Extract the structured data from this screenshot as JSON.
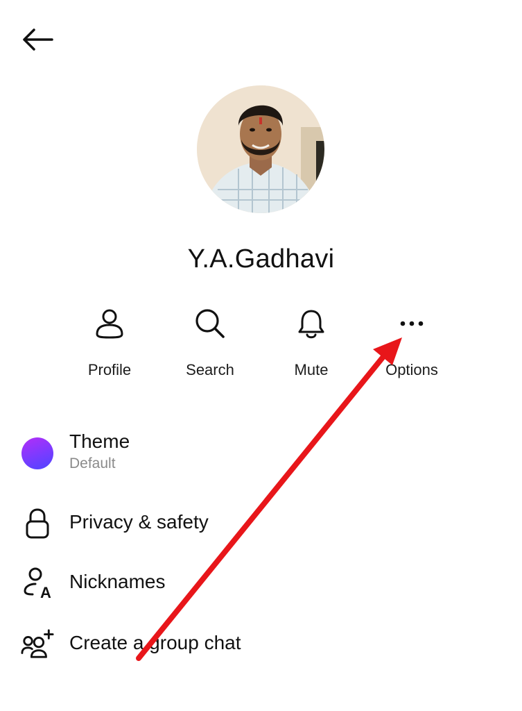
{
  "header": {
    "back_icon": "arrow-left-icon"
  },
  "profile": {
    "name": "Y.A.Gadhavi",
    "avatar_icon": "profile-photo"
  },
  "actions": [
    {
      "label": "Profile",
      "icon": "person-icon"
    },
    {
      "label": "Search",
      "icon": "search-icon"
    },
    {
      "label": "Mute",
      "icon": "bell-icon"
    },
    {
      "label": "Options",
      "icon": "more-options-icon"
    }
  ],
  "settings": {
    "theme": {
      "title": "Theme",
      "subtitle": "Default",
      "icon": "theme-color-dot",
      "gradient_from": "#a033ff",
      "gradient_to": "#5b3cff"
    },
    "privacy": {
      "title": "Privacy & safety",
      "icon": "lock-icon"
    },
    "nicknames": {
      "title": "Nicknames",
      "icon": "nickname-icon"
    },
    "group": {
      "title": "Create a group chat",
      "icon": "add-group-icon"
    }
  },
  "annotation": {
    "arrow_color": "#e8161a",
    "icon": "red-arrow-pointing-to-options"
  }
}
